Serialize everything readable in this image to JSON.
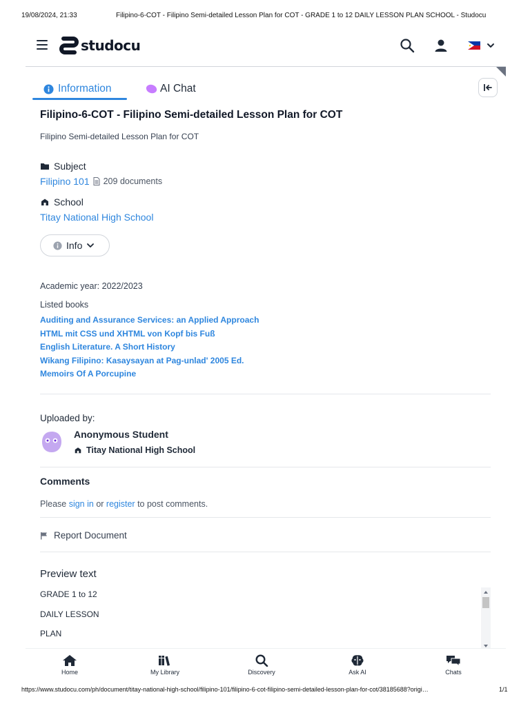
{
  "print_header": {
    "timestamp": "19/08/2024, 21:33",
    "title": "Filipino-6-COT - Filipino Semi-detailed Lesson Plan for COT - GRADE 1 to 12 DAILY LESSON PLAN SCHOOL - Studocu"
  },
  "print_footer": {
    "url": "https://www.studocu.com/ph/document/titay-national-high-school/filipino-101/filipino-6-cot-filipino-semi-detailed-lesson-plan-for-cot/38185688?origi…",
    "page": "1/1"
  },
  "brand": {
    "name": "studocu",
    "accent": "#2e86de"
  },
  "header_icons": [
    "menu-icon",
    "search-icon",
    "user-icon",
    "philippines-flag-icon",
    "chevron-down-icon"
  ],
  "tabs": [
    {
      "label": "Information",
      "icon": "info-icon",
      "active": true
    },
    {
      "label": "AI Chat",
      "icon": "ai-chat-blob-icon",
      "active": false
    }
  ],
  "document": {
    "title": "Filipino-6-COT - Filipino Semi-detailed Lesson Plan for COT",
    "subtitle": "Filipino Semi-detailed Lesson Plan for COT"
  },
  "subject": {
    "label": "Subject",
    "name": "Filipino 101",
    "doc_count": "209 documents"
  },
  "school": {
    "label": "School",
    "name": "Titay National High School"
  },
  "info_button": "Info",
  "academic_year": "Academic year: 2022/2023",
  "listed_books": {
    "label": "Listed books",
    "items": [
      "Auditing and Assurance Services: an Applied Approach",
      "HTML mit CSS und XHTML von Kopf bis Fuß",
      "English Literature. A Short History",
      "Wikang Filipino: Kasaysayan at Pag-unlad' 2005 Ed.",
      "Memoirs Of A Porcupine"
    ]
  },
  "uploader": {
    "heading": "Uploaded by:",
    "name": "Anonymous Student",
    "school": "Titay National High School"
  },
  "comments": {
    "heading": "Comments",
    "text_pre": "Please ",
    "sign_in": "sign in",
    "text_mid": " or ",
    "register": "register",
    "text_post": " to post comments."
  },
  "report": "Report Document",
  "preview": {
    "heading": "Preview text",
    "lines": [
      "GRADE 1 to 12",
      "DAILY LESSON",
      "PLAN"
    ]
  },
  "bottom_nav": [
    {
      "label": "Home",
      "icon": "home-icon"
    },
    {
      "label": "My Library",
      "icon": "library-icon"
    },
    {
      "label": "Discovery",
      "icon": "search-icon"
    },
    {
      "label": "Ask AI",
      "icon": "brain-icon"
    },
    {
      "label": "Chats",
      "icon": "chat-bubbles-icon"
    }
  ]
}
